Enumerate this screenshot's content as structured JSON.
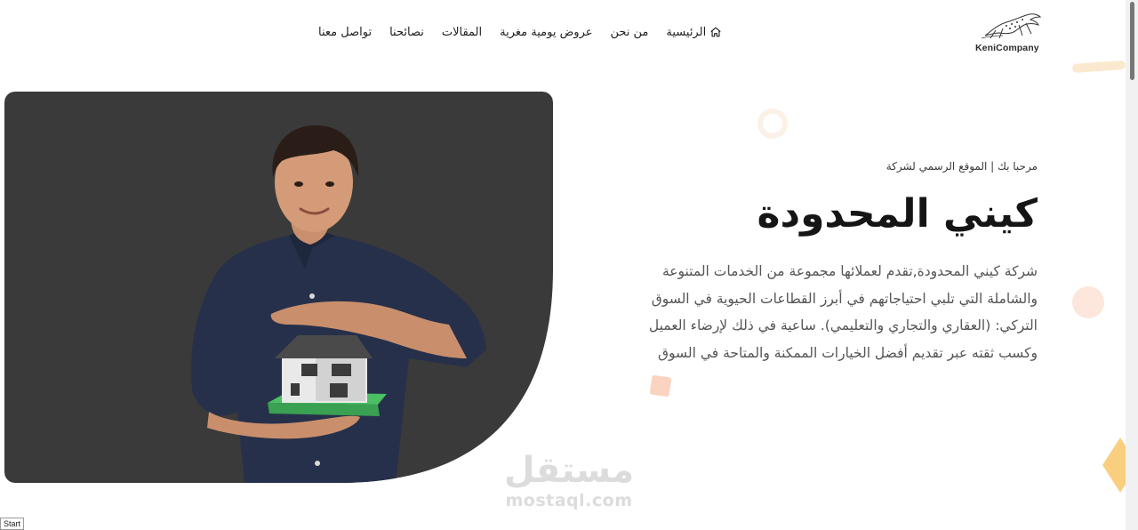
{
  "brand": {
    "logo_text": "KeniCompany",
    "accent_color": "#f8c768"
  },
  "nav": {
    "items": [
      {
        "label": "الرئيسية",
        "icon": "home-icon"
      },
      {
        "label": "من نحن"
      },
      {
        "label": "عروض يومية مغرية"
      },
      {
        "label": "المقالات"
      },
      {
        "label": "نصائحنا"
      },
      {
        "label": "تواصل معنا"
      }
    ]
  },
  "hero": {
    "welcome": "مرحبا بك | الموقع الرسمي لشركة",
    "title": "كيني المحدودة",
    "description": "شركة كيني المحدودة,تقدم لعملائها مجموعة من الخدمات المتنوعة والشاملة التي تلبي احتياجاتهم في أبرز القطاعات الحيوية في السوق التركي: (العقاري والتجاري والتعليمي). ساعية في ذلك لإرضاء العميل وكسب ثقته عبر تقديم أفضل الخيارات الممكنة والمتاحة في السوق",
    "image": "man-holding-house-model",
    "panel_color": "#3a3a3a"
  },
  "watermark": {
    "arabic": "مستقل",
    "latin": "mostaql.com"
  },
  "start_tag": "Start"
}
